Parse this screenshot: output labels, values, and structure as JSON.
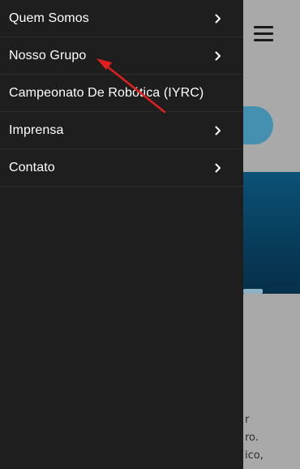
{
  "menu": {
    "items": [
      {
        "label": "Quem Somos",
        "has_submenu": true
      },
      {
        "label": "Nosso Grupo",
        "has_submenu": true
      },
      {
        "label": "Campeonato De Robótica (IYRC)",
        "has_submenu": false
      },
      {
        "label": "Imprensa",
        "has_submenu": true
      },
      {
        "label": "Contato",
        "has_submenu": true
      }
    ]
  },
  "background_page": {
    "text_fragments": [
      "r",
      "ro.",
      "ico,"
    ]
  },
  "icons": {
    "menu_toggle": "hamburger-icon",
    "submenu": "chevron-right-icon",
    "annotation": "red-arrow"
  },
  "colors": {
    "drawer_bg": "#1e1e1e",
    "overlay": "#a9a9a9",
    "accent_pill": "#4590b0",
    "hero": "#0c5277",
    "annotation_arrow": "#e31e1e"
  }
}
